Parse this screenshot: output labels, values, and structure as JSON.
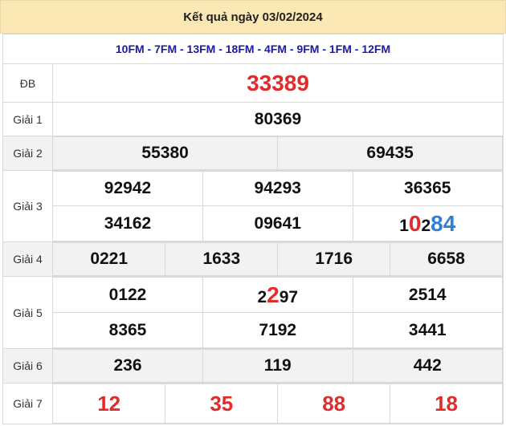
{
  "header": {
    "title": "Kết quả ngày 03/02/2024"
  },
  "provinces": "10FM - 7FM - 13FM - 18FM - 4FM - 9FM - 1FM - 12FM",
  "prizes": {
    "db": {
      "label": "ĐB",
      "value": "33389"
    },
    "g1": {
      "label": "Giải 1",
      "value": "80369"
    },
    "g2": {
      "label": "Giải 2",
      "values": [
        "55380",
        "69435"
      ]
    },
    "g3": {
      "label": "Giải 3",
      "values": [
        "92942",
        "94293",
        "36365",
        "34162",
        "09641"
      ],
      "last_parts": [
        "1",
        "0",
        "2",
        "84"
      ]
    },
    "g4": {
      "label": "Giải 4",
      "values": [
        "0221",
        "1633",
        "1716",
        "6658"
      ]
    },
    "g5": {
      "label": "Giải 5",
      "first_row": [
        "0122",
        "2",
        "2",
        "97",
        "2514"
      ],
      "values": [
        "8365",
        "7192",
        "3441"
      ]
    },
    "g6": {
      "label": "Giải 6",
      "values": [
        "236",
        "119",
        "442"
      ]
    },
    "g7": {
      "label": "Giải 7",
      "values": [
        "12",
        "35",
        "88",
        "18"
      ]
    }
  },
  "colors": {
    "header_bg": "#fbe8b5",
    "province": "#1a1aa6",
    "highlight_red": "#e32b2b",
    "highlight_blue": "#2d7fd8"
  }
}
